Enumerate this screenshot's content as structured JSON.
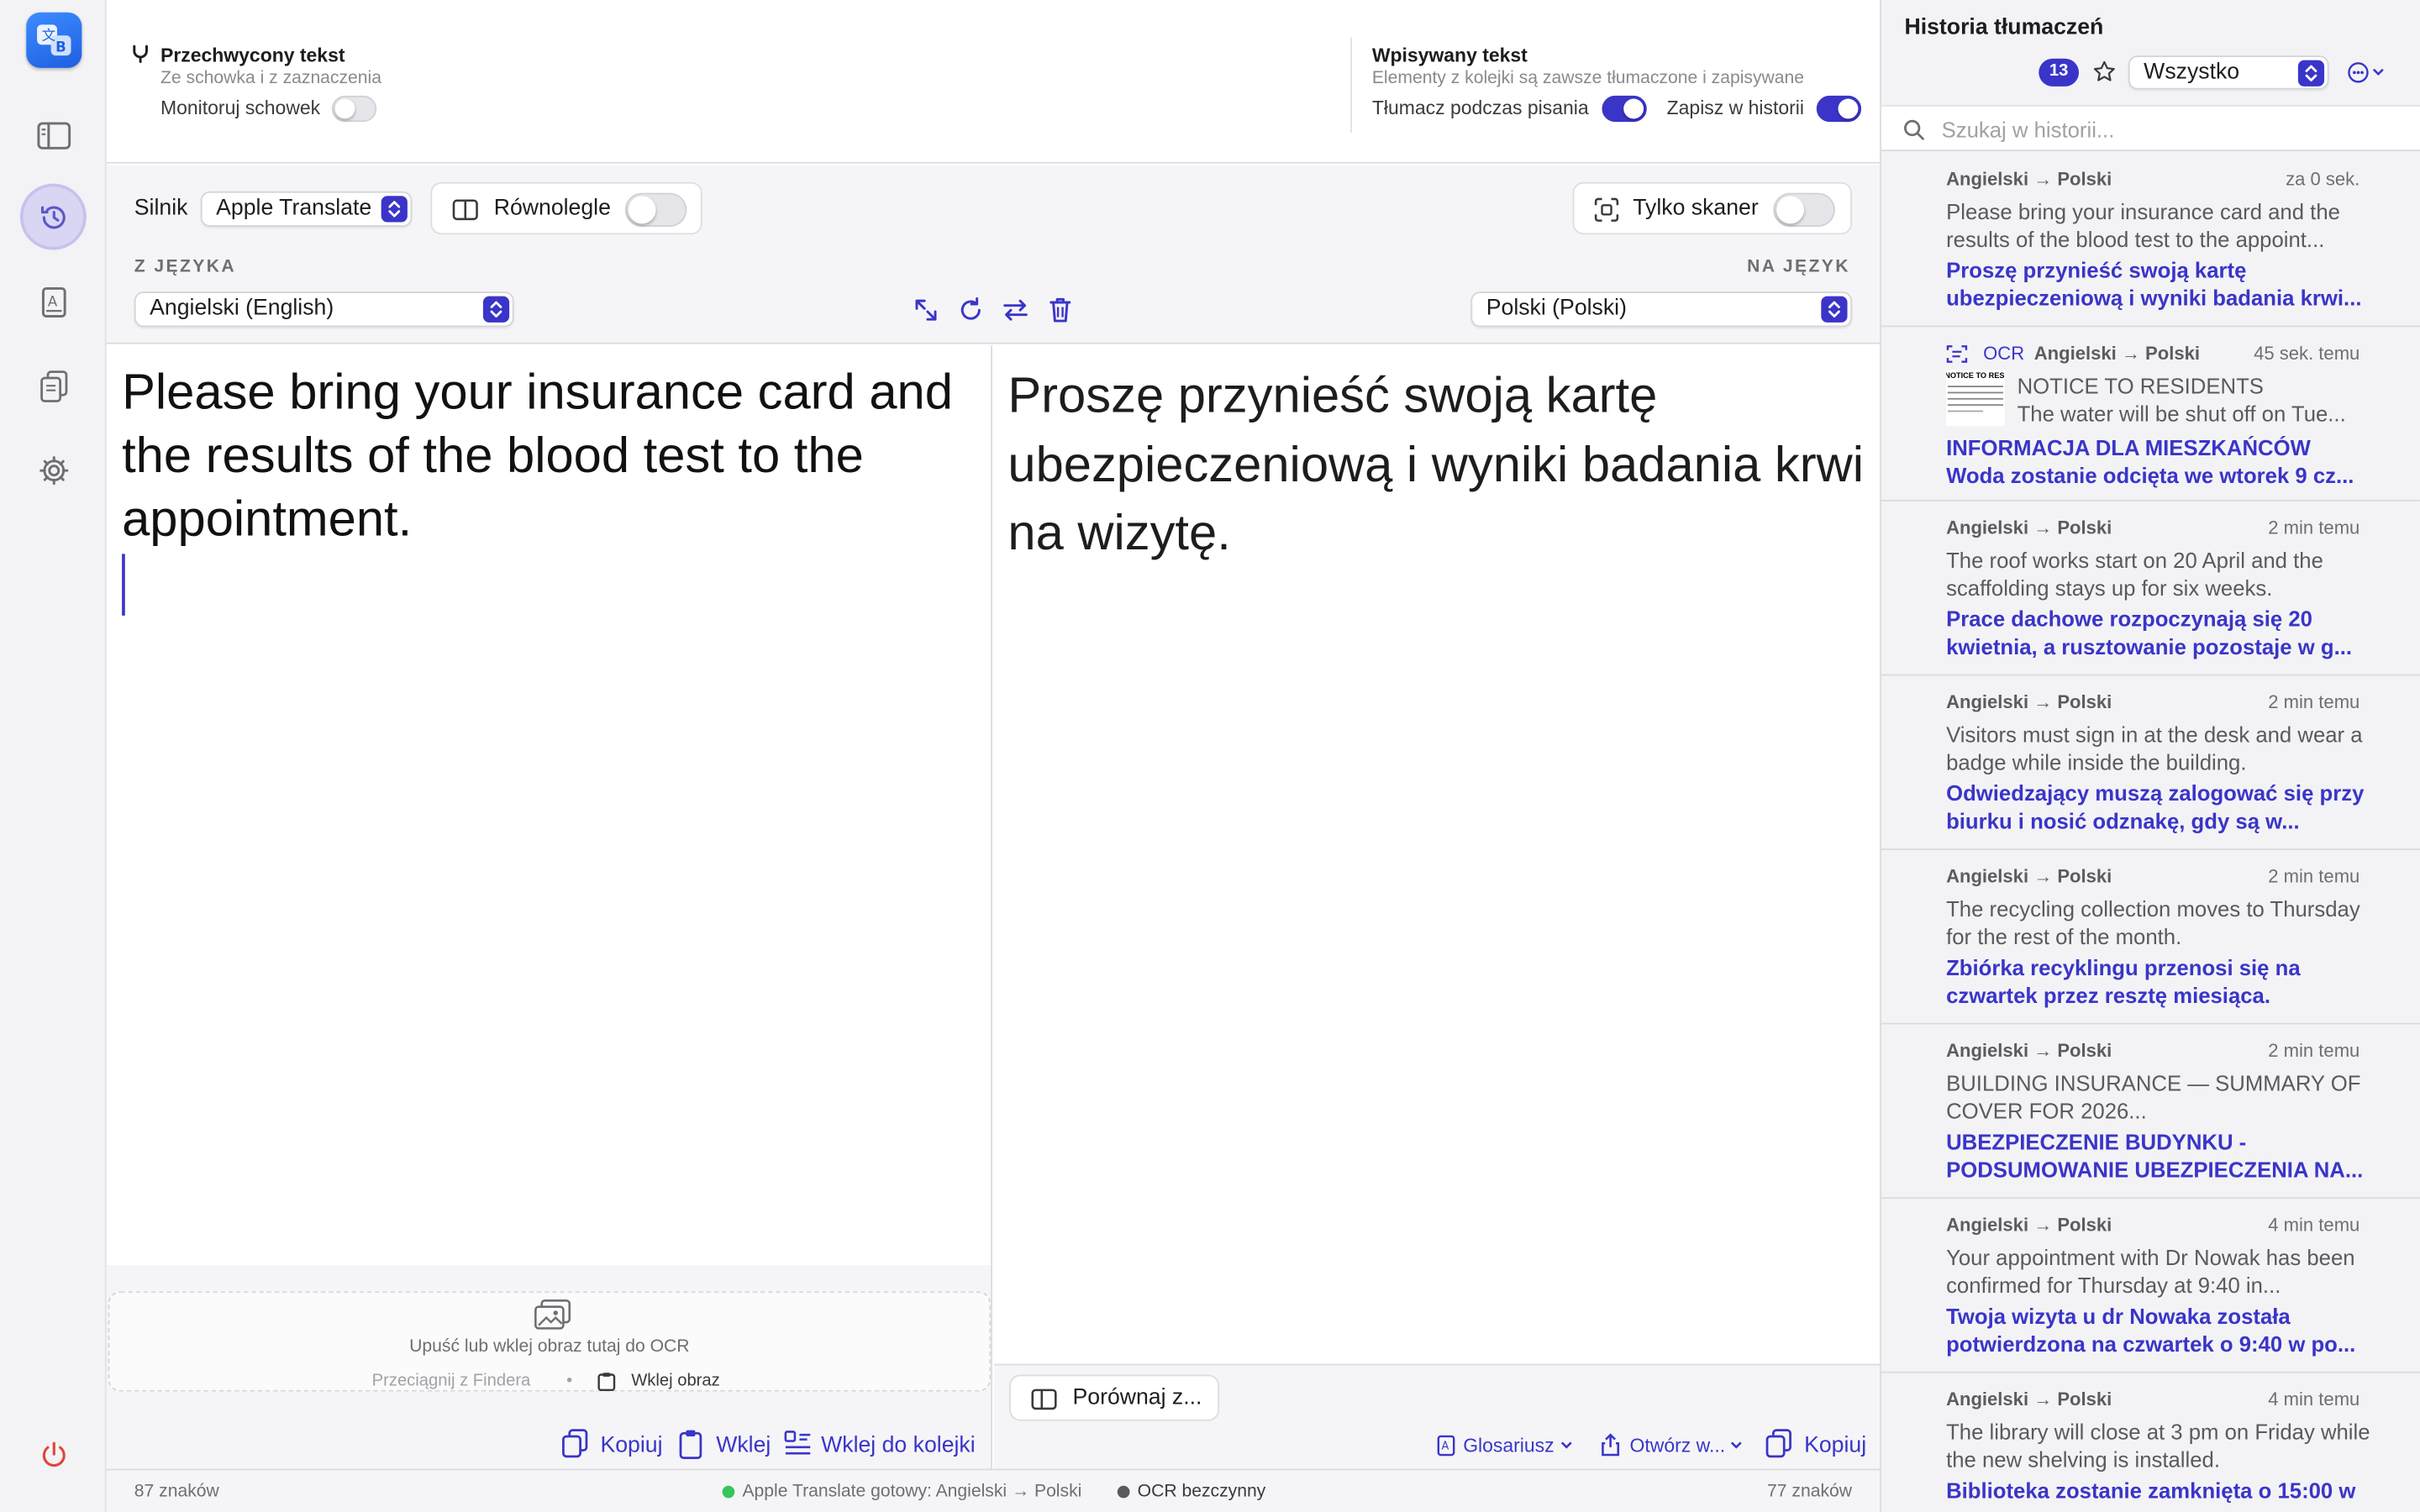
{
  "capture": {
    "title": "Przechwycony tekst",
    "subtitle": "Ze schowka i z zaznaczenia",
    "monitor_label": "Monitoruj schowek",
    "monitor_on": false
  },
  "typed": {
    "title": "Wpisywany tekst",
    "subtitle": "Elementy z kolejki są zawsze tłumaczone i zapisywane",
    "translate_while_typing_label": "Tłumacz podczas pisania",
    "translate_while_typing_on": true,
    "save_history_label": "Zapisz w historii",
    "save_history_on": true
  },
  "toolbar": {
    "engine_label": "Silnik",
    "engine_value": "Apple Translate",
    "parallel_label": "Równolegle",
    "parallel_on": false,
    "scanner_label": "Tylko skaner",
    "scanner_on": false,
    "from_header": "Z JĘZYKA",
    "to_header": "NA JĘZYK",
    "from_value": "Angielski (English)",
    "to_value": "Polski (Polski)"
  },
  "source": {
    "text": "Please bring your insurance card and the results of the blood test to the appointment."
  },
  "target": {
    "text": "Proszę przynieść swoją kartę ubezpieczeniową i wyniki badania krwi na wizytę."
  },
  "ocr_drop": {
    "message": "Upuść lub wklej obraz tutaj do OCR",
    "drag_label": "Przeciągnij z Findera",
    "paste_image_label": "Wklej obraz"
  },
  "left_actions": {
    "copy": "Kopiuj",
    "paste": "Wklej",
    "paste_queue": "Wklej do kolejki"
  },
  "right_actions": {
    "compare": "Porównaj z...",
    "glossary": "Glosariusz",
    "open_in": "Otwórz w...",
    "copy": "Kopiuj"
  },
  "status": {
    "left_count": "87 znaków",
    "engine_status": "Apple Translate gotowy: Angielski → Polski",
    "engine_color": "#34c759",
    "ocr_status": "OCR bezczynny",
    "ocr_color": "#5a5a5e",
    "right_count": "77 znaków"
  },
  "history": {
    "title": "Historia tłumaczeń",
    "count": "13",
    "filter_value": "Wszystko",
    "search_placeholder": "Szukaj w historii...",
    "items": [
      {
        "lang": "Angielski → Polski",
        "time": "za 0 sek.",
        "ocr": false,
        "src": "Please bring your insurance card and the results of the blood test to the appoint...",
        "tgt": "Proszę przynieść swoją kartę ubezpieczeniową i wyniki badania krwi..."
      },
      {
        "lang": "Angielski → Polski",
        "time": "45 sek. temu",
        "ocr": true,
        "ocr_label": "OCR",
        "src": "NOTICE TO RESIDENTS",
        "src2": "The water will be shut off on Tue...",
        "tgt": "INFORMACJA DLA MIESZKAŃCÓW",
        "tgt2": "Woda zostanie odcięta we wtorek 9 cz..."
      },
      {
        "lang": "Angielski → Polski",
        "time": "2 min temu",
        "ocr": false,
        "src": "The roof works start on 20 April and the scaffolding stays up for six weeks.",
        "tgt": "Prace dachowe rozpoczynają się 20 kwietnia, a rusztowanie pozostaje w g..."
      },
      {
        "lang": "Angielski → Polski",
        "time": "2 min temu",
        "ocr": false,
        "src": "Visitors must sign in at the desk and wear a badge while inside the building.",
        "tgt": "Odwiedzający muszą zalogować się przy biurku i nosić odznakę, gdy są w..."
      },
      {
        "lang": "Angielski → Polski",
        "time": "2 min temu",
        "ocr": false,
        "src": "The recycling collection moves to Thursday for the rest of the month.",
        "tgt": "Zbiórka recyklingu przenosi się na czwartek przez resztę miesiąca."
      },
      {
        "lang": "Angielski → Polski",
        "time": "2 min temu",
        "ocr": false,
        "src": "BUILDING INSURANCE — SUMMARY OF COVER FOR 2026...",
        "tgt": "UBEZPIECZENIE BUDYNKU - PODSUMOWANIE UBEZPIECZENIA NA..."
      },
      {
        "lang": "Angielski → Polski",
        "time": "4 min temu",
        "ocr": false,
        "src": "Your appointment with Dr Nowak has been confirmed for Thursday at 9:40 in...",
        "tgt": "Twoja wizyta u dr Nowaka została potwierdzona na czwartek o 9:40 w po..."
      },
      {
        "lang": "Angielski → Polski",
        "time": "4 min temu",
        "ocr": false,
        "src": "The library will close at 3 pm on Friday while the new shelving is installed.",
        "tgt": "Biblioteka zostanie zamknięta o 15:00 w"
      }
    ]
  }
}
